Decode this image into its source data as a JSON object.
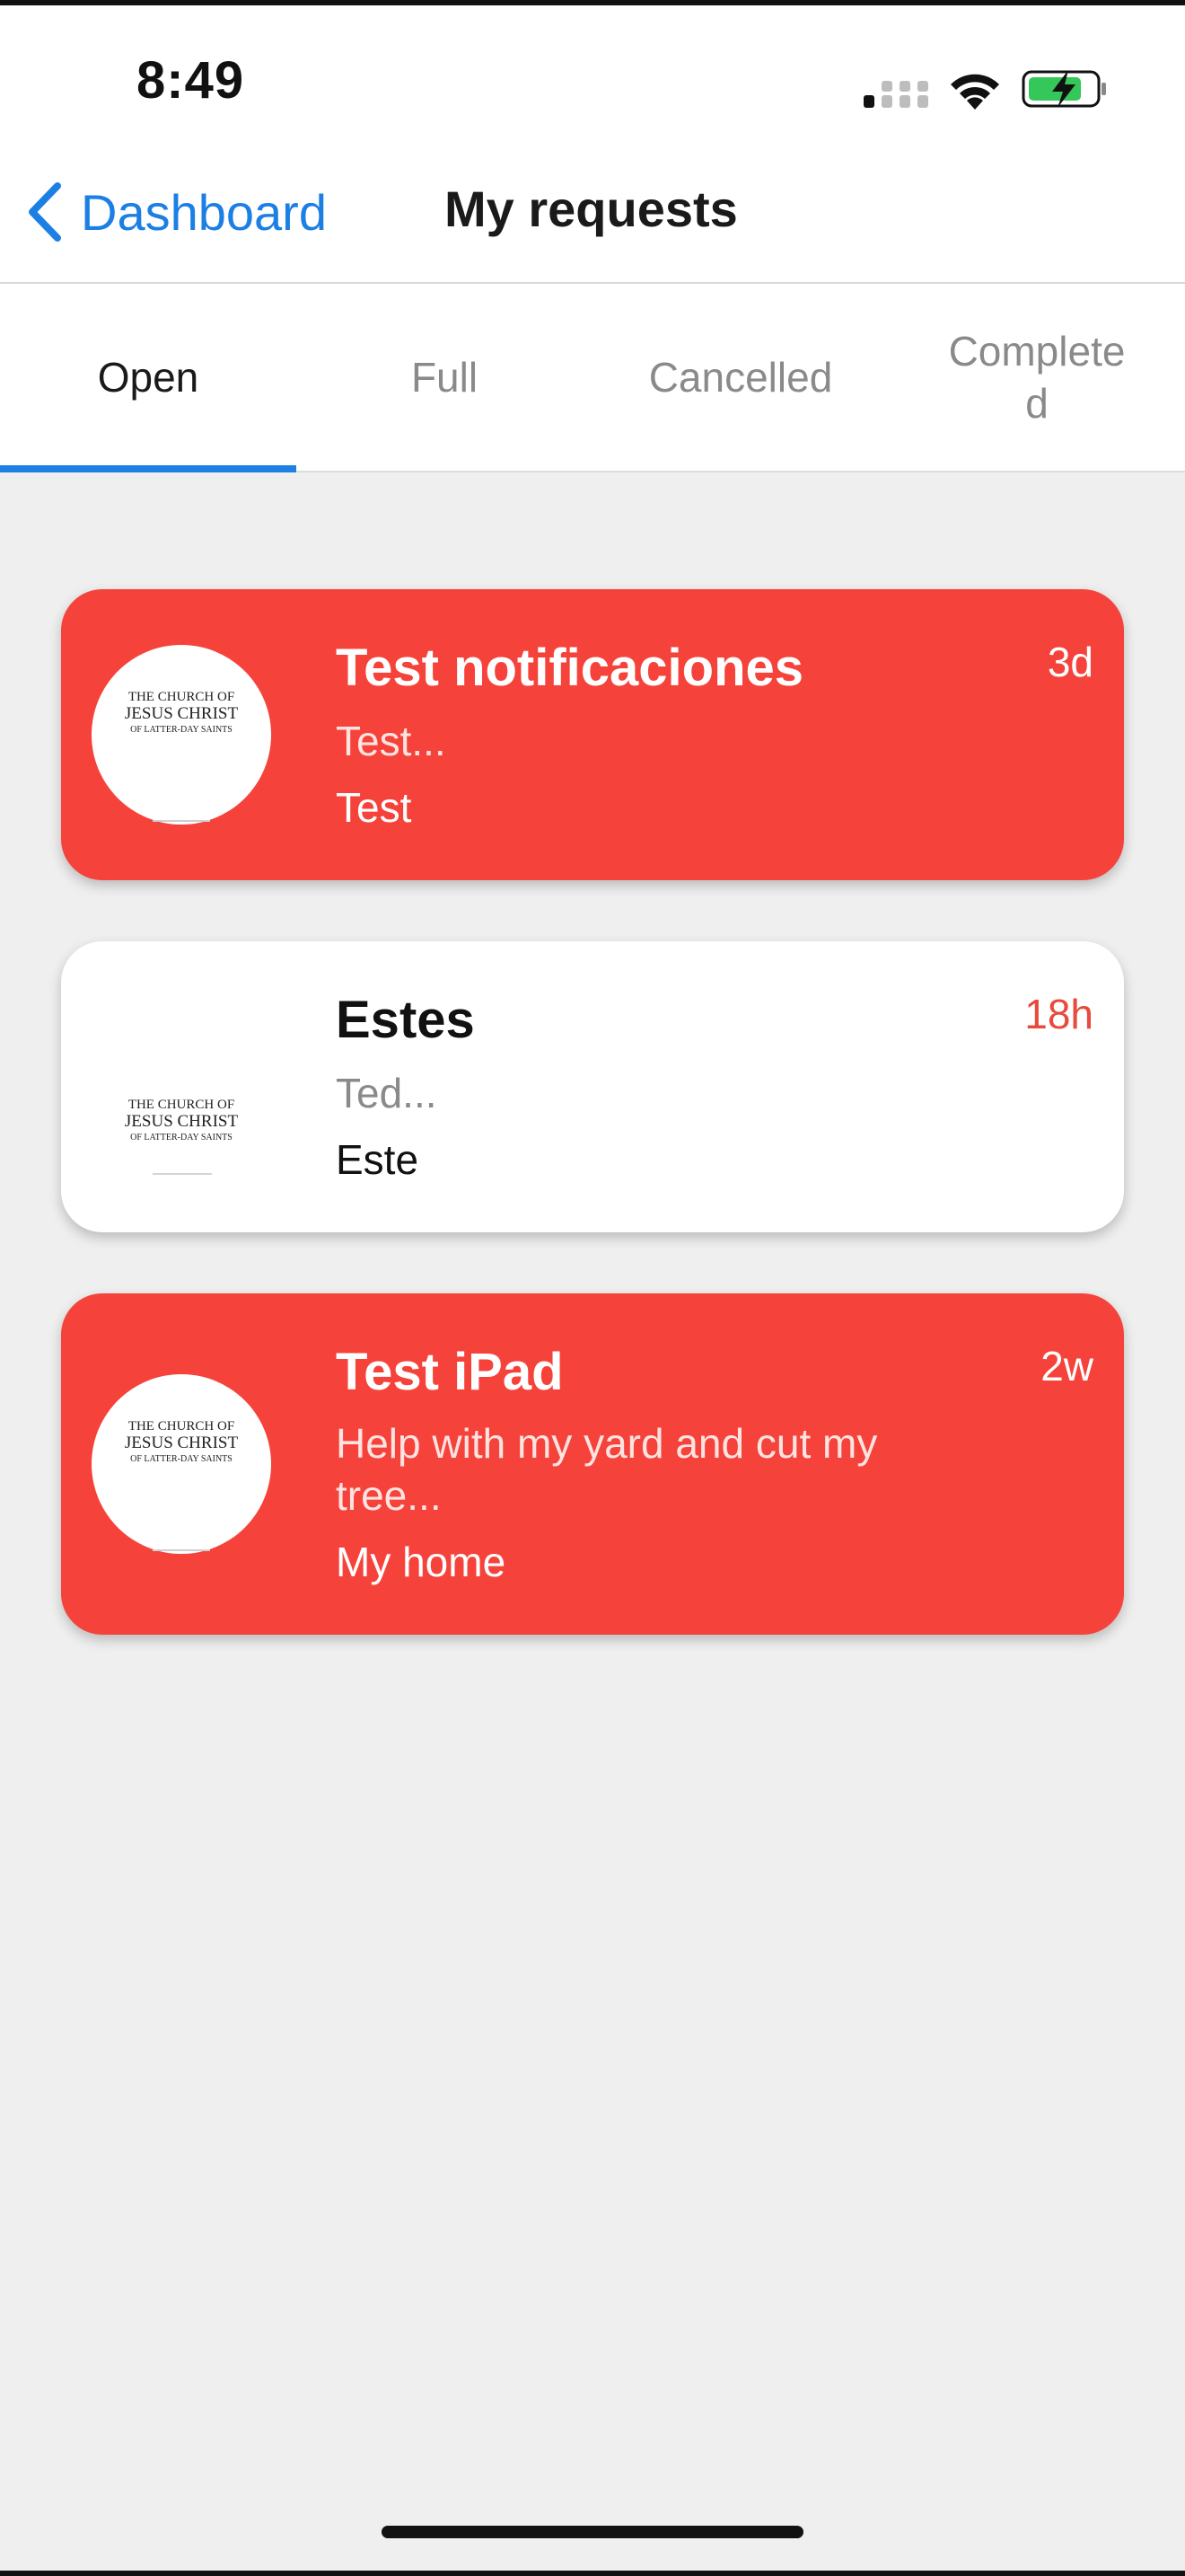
{
  "status_bar": {
    "time": "8:49",
    "icons": [
      "cellular-signal-icon",
      "wifi-icon",
      "battery-charging-icon"
    ],
    "battery_color": "#35c759"
  },
  "nav": {
    "back_label": "Dashboard",
    "title": "My requests",
    "accent_color": "#1b7fe3"
  },
  "tabs": [
    {
      "label": "Open",
      "active": true
    },
    {
      "label": "Full",
      "active": false
    },
    {
      "label": "Cancelled",
      "active": false
    },
    {
      "label": "Complete\nd",
      "active": false
    }
  ],
  "logo_text": {
    "line1": "THE CHURCH OF",
    "line2": "JESUS CHRIST",
    "line3": "OF LATTER-DAY SAINTS"
  },
  "requests": [
    {
      "title": "Test notificaciones",
      "description": "Test...",
      "location": "Test",
      "age": "3d",
      "style": "red"
    },
    {
      "title": "Estes",
      "description": "Ted...",
      "location": "Este",
      "age": "18h",
      "style": "white"
    },
    {
      "title": "Test iPad",
      "description": "Help with my yard and cut my tree...",
      "location": "My home",
      "age": "2w",
      "style": "red"
    }
  ],
  "colors": {
    "card_red": "#f5433b",
    "background": "#efefef"
  }
}
